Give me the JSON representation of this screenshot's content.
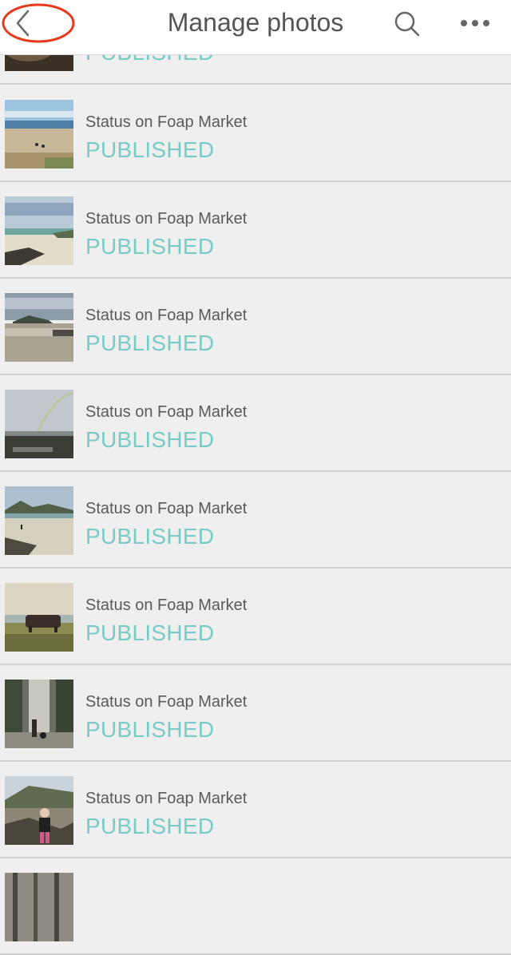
{
  "header": {
    "title": "Manage photos",
    "back_icon": "chevron-left-icon",
    "search_icon": "search-icon",
    "more_icon": "more-horizontal-icon",
    "back_highlight_color": "#e8391c"
  },
  "rows": [
    {
      "label": "",
      "status": "PUBLISHED",
      "thumb": "dark-rock"
    },
    {
      "label": "Status on Foap Market",
      "status": "PUBLISHED",
      "thumb": "beach-people"
    },
    {
      "label": "Status on Foap Market",
      "status": "PUBLISHED",
      "thumb": "beach-rocks"
    },
    {
      "label": "Status on Foap Market",
      "status": "PUBLISHED",
      "thumb": "beach-wet-sand"
    },
    {
      "label": "Status on Foap Market",
      "status": "PUBLISHED",
      "thumb": "rainbow-coast"
    },
    {
      "label": "Status on Foap Market",
      "status": "PUBLISHED",
      "thumb": "beach-hills"
    },
    {
      "label": "Status on Foap Market",
      "status": "PUBLISHED",
      "thumb": "cow-field"
    },
    {
      "label": "Status on Foap Market",
      "status": "PUBLISHED",
      "thumb": "forest-path"
    },
    {
      "label": "Status on Foap Market",
      "status": "PUBLISHED",
      "thumb": "child-rocks"
    },
    {
      "label": "",
      "status": "",
      "thumb": "trees"
    }
  ],
  "colors": {
    "status": "#79cbc6",
    "label": "#5a5a5a",
    "background": "#efefef"
  }
}
